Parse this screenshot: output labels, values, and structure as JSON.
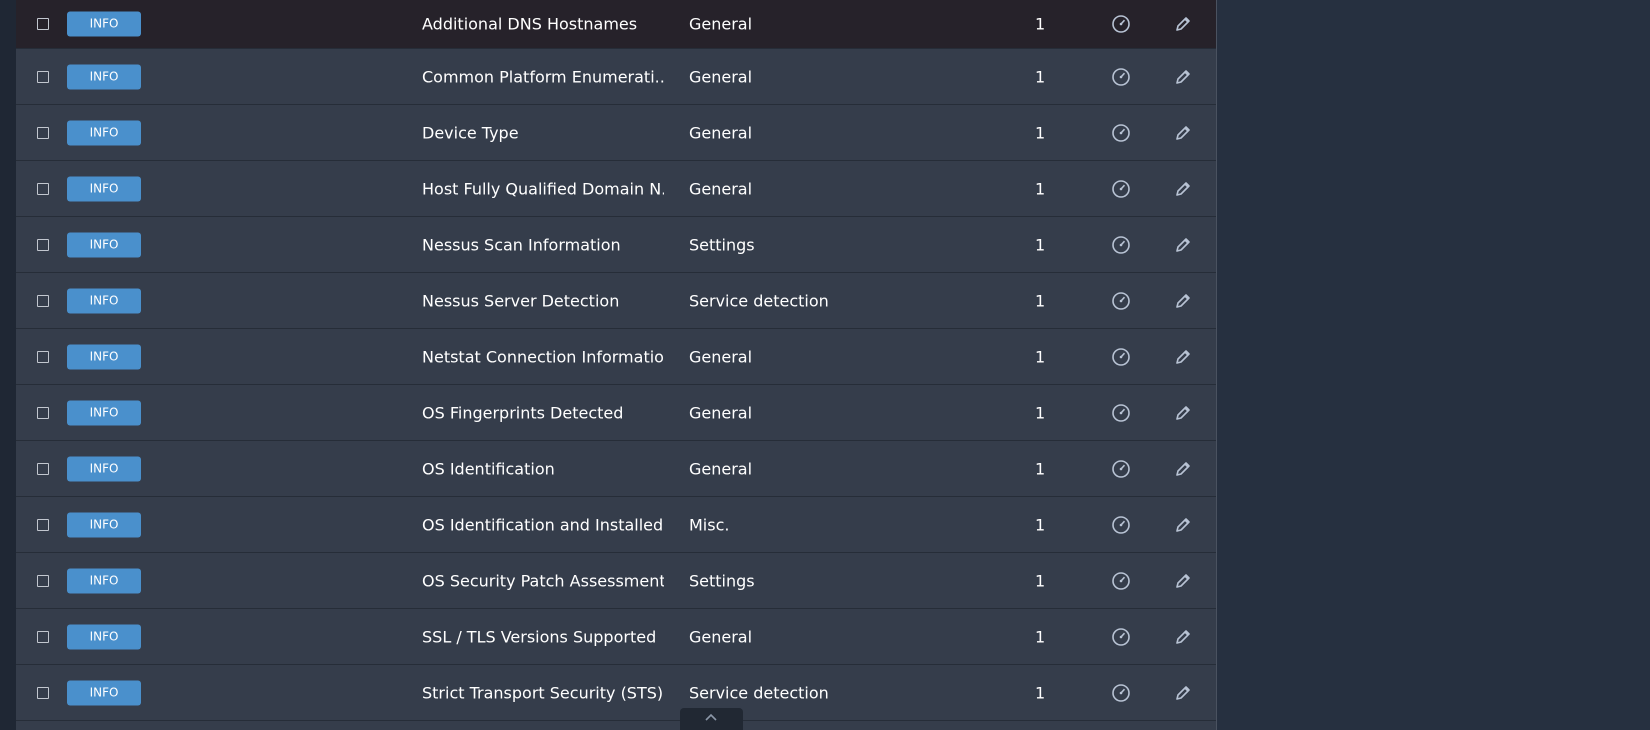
{
  "colors": {
    "page_background": "#263040",
    "table_background": "#353d4b",
    "hovered_row_background": "#26222a",
    "badge_info": "#4a90cc",
    "text": "#ffffff",
    "icon": "#b8c3d4"
  },
  "rows": [
    {
      "severity": "INFO",
      "name": "Additional DNS Hostnames",
      "family": "General",
      "count": "1",
      "icons": [
        "snooze-icon",
        "edit-icon"
      ]
    },
    {
      "severity": "INFO",
      "name": "Common Platform Enumerati...",
      "family": "General",
      "count": "1",
      "icons": [
        "snooze-icon",
        "edit-icon"
      ]
    },
    {
      "severity": "INFO",
      "name": "Device Type",
      "family": "General",
      "count": "1",
      "icons": [
        "snooze-icon",
        "edit-icon"
      ]
    },
    {
      "severity": "INFO",
      "name": "Host Fully Qualified Domain N...",
      "family": "General",
      "count": "1",
      "icons": [
        "snooze-icon",
        "edit-icon"
      ]
    },
    {
      "severity": "INFO",
      "name": "Nessus Scan Information",
      "family": "Settings",
      "count": "1",
      "icons": [
        "snooze-icon",
        "edit-icon"
      ]
    },
    {
      "severity": "INFO",
      "name": "Nessus Server Detection",
      "family": "Service detection",
      "count": "1",
      "icons": [
        "snooze-icon",
        "edit-icon"
      ]
    },
    {
      "severity": "INFO",
      "name": "Netstat Connection Information",
      "family": "General",
      "count": "1",
      "icons": [
        "snooze-icon",
        "edit-icon"
      ]
    },
    {
      "severity": "INFO",
      "name": "OS Fingerprints Detected",
      "family": "General",
      "count": "1",
      "icons": [
        "snooze-icon",
        "edit-icon"
      ]
    },
    {
      "severity": "INFO",
      "name": "OS Identification",
      "family": "General",
      "count": "1",
      "icons": [
        "snooze-icon",
        "edit-icon"
      ]
    },
    {
      "severity": "INFO",
      "name": "OS Identification and Installed...",
      "family": "Misc.",
      "count": "1",
      "icons": [
        "snooze-icon",
        "edit-icon"
      ]
    },
    {
      "severity": "INFO",
      "name": "OS Security Patch Assessment...",
      "family": "Settings",
      "count": "1",
      "icons": [
        "snooze-icon",
        "edit-icon"
      ]
    },
    {
      "severity": "INFO",
      "name": "SSL / TLS Versions Supported",
      "family": "General",
      "count": "1",
      "icons": [
        "snooze-icon",
        "edit-icon"
      ]
    },
    {
      "severity": "INFO",
      "name": "Strict Transport Security (STS) ...",
      "family": "Service detection",
      "count": "1",
      "icons": [
        "snooze-icon",
        "edit-icon"
      ]
    }
  ],
  "scroll_handle_icon": "chevron-up-icon"
}
